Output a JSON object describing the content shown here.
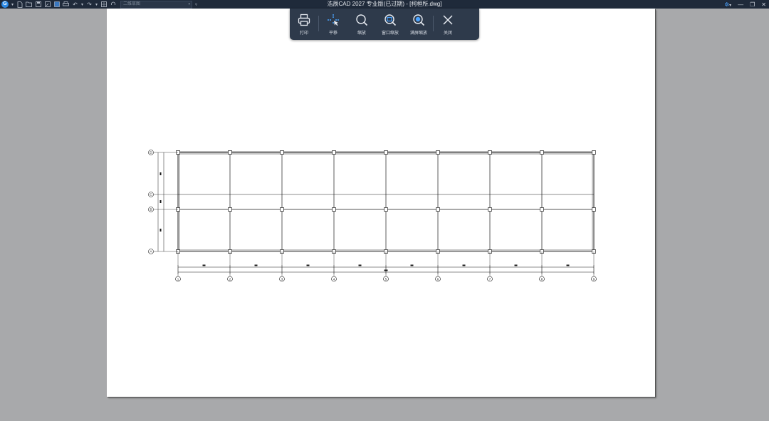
{
  "titlebar": {
    "workspace": "二维草图",
    "title": "浩辰CAD 2027 专业版(已过期) - [柯桓所.dwg]"
  },
  "quick_access": [
    "new-icon",
    "open-icon",
    "save-icon",
    "save-as-icon",
    "save-all-icon",
    "print-icon",
    "undo-icon",
    "redo-icon",
    "layout-icon",
    "help-icon"
  ],
  "preview_toolbar": {
    "print": "打印",
    "pan": "平移",
    "zoom": "缩放",
    "window_zoom": "窗口缩放",
    "zoom_extents": "满屏缩放",
    "close": "关闭"
  },
  "drawing": {
    "axis_numbers": [
      "1",
      "2",
      "3",
      "4",
      "5",
      "6",
      "7",
      "8",
      "9"
    ],
    "axis_letters": [
      "D",
      "C",
      "B",
      "A"
    ]
  },
  "colors": {
    "titlebar_bg": "#1f2a3a",
    "toolbar_bg": "#2e3a4b",
    "workspace_bg": "#a8a9ab",
    "paper": "#ffffff",
    "accent": "#4aa3ff"
  }
}
